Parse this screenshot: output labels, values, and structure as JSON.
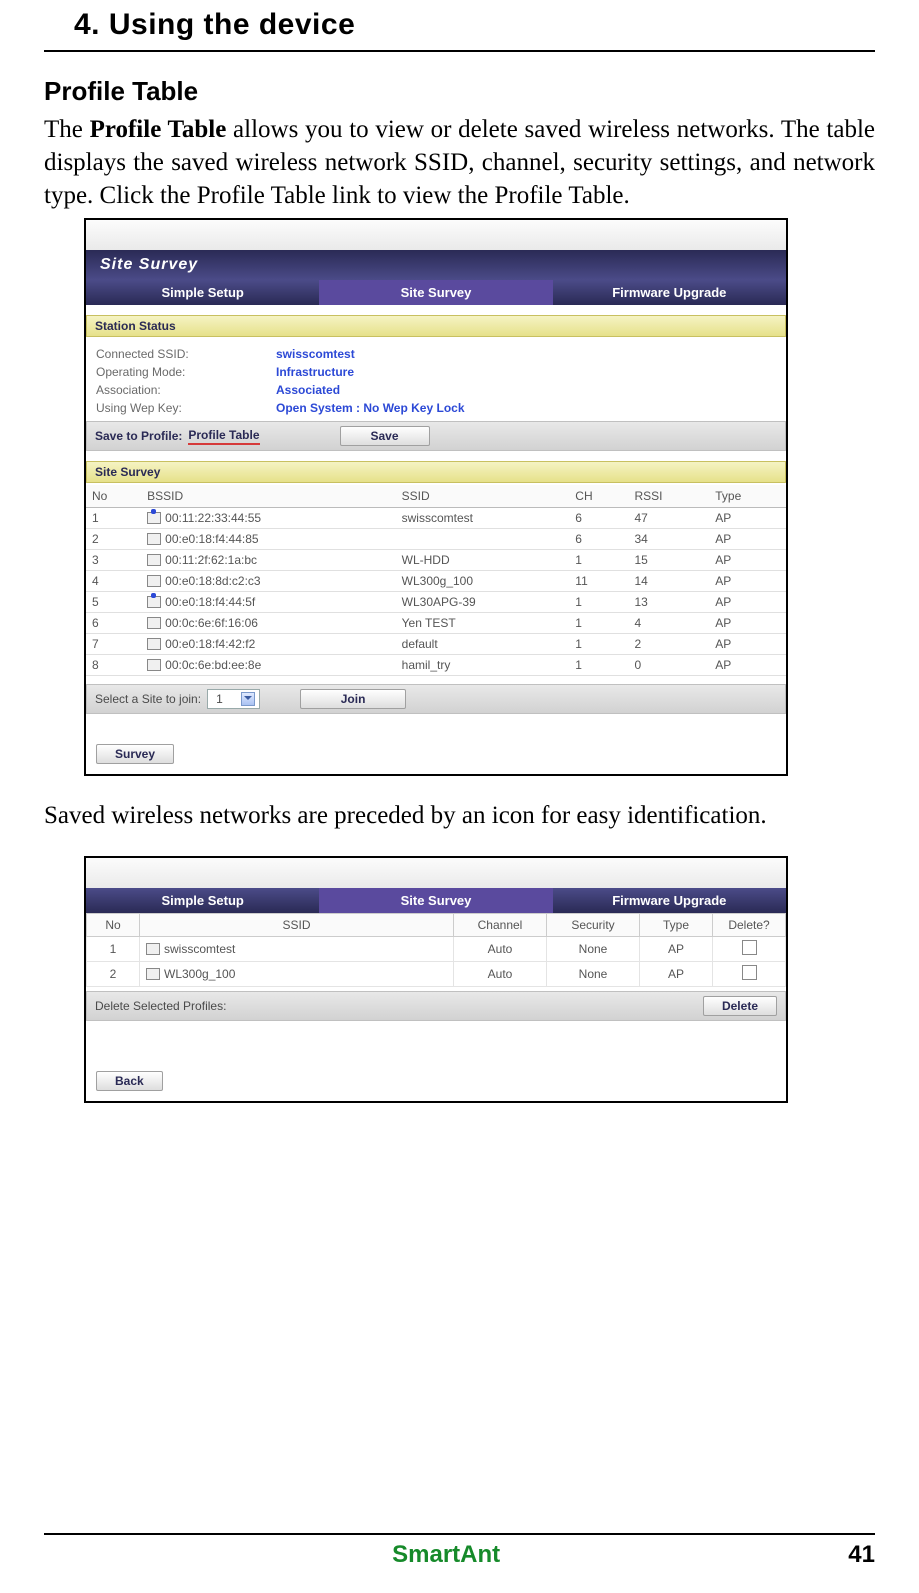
{
  "chapter_title": "4. Using the device",
  "section_title": "Profile Table",
  "intro_text_pre": "The ",
  "intro_bold": "Profile Table",
  "intro_text_post": " allows you to view or delete saved wireless networks. The table displays the saved wireless network SSID, channel, security settings, and network type. Click the Profile Table link to view the Profile Table.",
  "caption_text": "Saved wireless networks are preceded by an icon for easy identification.",
  "footer_brand": "SmartAnt",
  "footer_page": "41",
  "shot1": {
    "brand": "Site Survey",
    "tabs": {
      "a": "Simple Setup",
      "b": "Site Survey",
      "c": "Firmware Upgrade"
    },
    "station_bar": "Station Status",
    "status": {
      "l1": "Connected SSID:",
      "v1": "swisscomtest",
      "l2": "Operating Mode:",
      "v2": "Infrastructure",
      "l3": "Association:",
      "v3": "Associated",
      "l4": "Using Wep Key:",
      "v4": "Open System : No Wep Key Lock"
    },
    "save_label": "Save to Profile:",
    "profile_link": "Profile Table",
    "save_btn": "Save",
    "survey_bar": "Site Survey",
    "cols": {
      "no": "No",
      "bssid": "BSSID",
      "ssid": "SSID",
      "ch": "CH",
      "rssi": "RSSI",
      "type": "Type"
    },
    "rows": [
      {
        "no": "1",
        "bssid": "00:11:22:33:44:55",
        "ssid": "swisscomtest",
        "ch": "6",
        "rssi": "47",
        "type": "AP",
        "saved": true
      },
      {
        "no": "2",
        "bssid": "00:e0:18:f4:44:85",
        "ssid": "",
        "ch": "6",
        "rssi": "34",
        "type": "AP",
        "saved": false
      },
      {
        "no": "3",
        "bssid": "00:11:2f:62:1a:bc",
        "ssid": "WL-HDD",
        "ch": "1",
        "rssi": "15",
        "type": "AP",
        "saved": false
      },
      {
        "no": "4",
        "bssid": "00:e0:18:8d:c2:c3",
        "ssid": "WL300g_100",
        "ch": "11",
        "rssi": "14",
        "type": "AP",
        "saved": false
      },
      {
        "no": "5",
        "bssid": "00:e0:18:f4:44:5f",
        "ssid": "WL30APG-39",
        "ch": "1",
        "rssi": "13",
        "type": "AP",
        "saved": true
      },
      {
        "no": "6",
        "bssid": "00:0c:6e:6f:16:06",
        "ssid": "Yen TEST",
        "ch": "1",
        "rssi": "4",
        "type": "AP",
        "saved": false
      },
      {
        "no": "7",
        "bssid": "00:e0:18:f4:42:f2",
        "ssid": "default",
        "ch": "1",
        "rssi": "2",
        "type": "AP",
        "saved": false
      },
      {
        "no": "8",
        "bssid": "00:0c:6e:bd:ee:8e",
        "ssid": "hamil_try",
        "ch": "1",
        "rssi": "0",
        "type": "AP",
        "saved": false
      }
    ],
    "join_label": "Select a Site to join:",
    "join_value": "1",
    "join_btn": "Join",
    "survey_btn": "Survey"
  },
  "shot2": {
    "tabs": {
      "a": "Simple Setup",
      "b": "Site Survey",
      "c": "Firmware Upgrade"
    },
    "cols": {
      "no": "No",
      "ssid": "SSID",
      "channel": "Channel",
      "security": "Security",
      "type": "Type",
      "delete": "Delete?"
    },
    "rows": [
      {
        "no": "1",
        "ssid": "swisscomtest",
        "channel": "Auto",
        "security": "None",
        "type": "AP"
      },
      {
        "no": "2",
        "ssid": "WL300g_100",
        "channel": "Auto",
        "security": "None",
        "type": "AP"
      }
    ],
    "delete_label": "Delete Selected Profiles:",
    "delete_btn": "Delete",
    "back_btn": "Back"
  }
}
